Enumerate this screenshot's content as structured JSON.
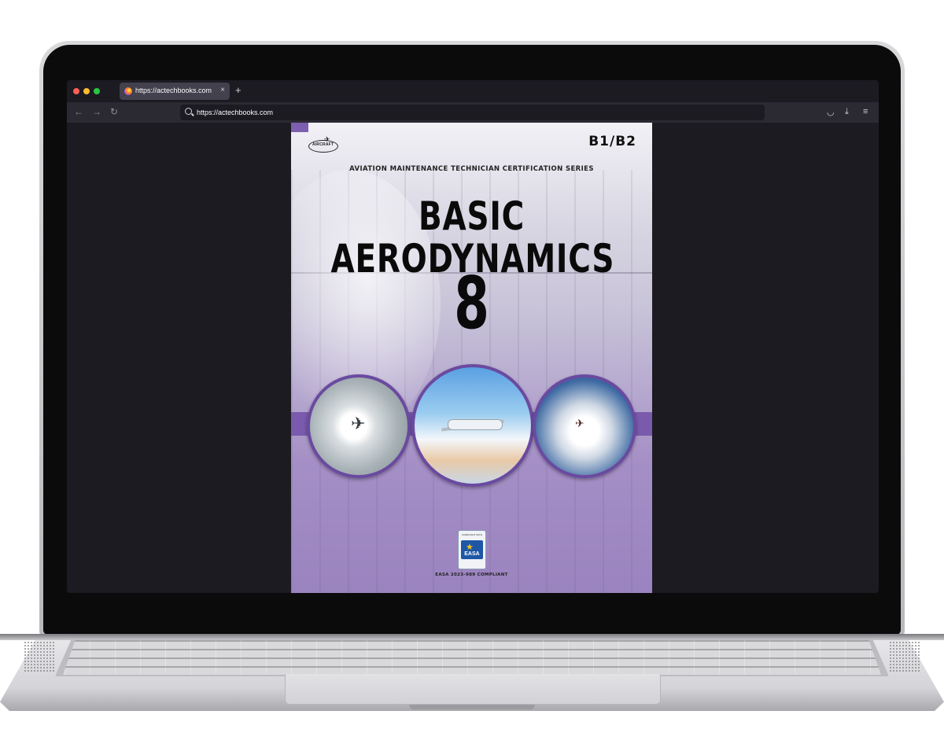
{
  "browser": {
    "tab_title": "https://actechbooks.com",
    "tab_close": "×",
    "new_tab": "+",
    "back": "←",
    "forward": "→",
    "reload": "↻",
    "url": "https://actechbooks.com",
    "menu": "≡",
    "download": "⤓",
    "pocket": "◡"
  },
  "cover": {
    "grade": "B1/B2",
    "series": "AVIATION MAINTENANCE TECHNICIAN CERTIFICATION SERIES",
    "title": "BASIC AERODYNAMICS",
    "module_number": "8",
    "logo_text": "AIRCRAFT",
    "easa_top": "COMPLIANT WITH",
    "easa_label": "EASA",
    "compliance": "EASA 2023-989 COMPLIANT"
  },
  "colors": {
    "accent": "#7a5aac",
    "browser_bg": "#1c1b22",
    "toolbar_bg": "#2b2a33"
  }
}
